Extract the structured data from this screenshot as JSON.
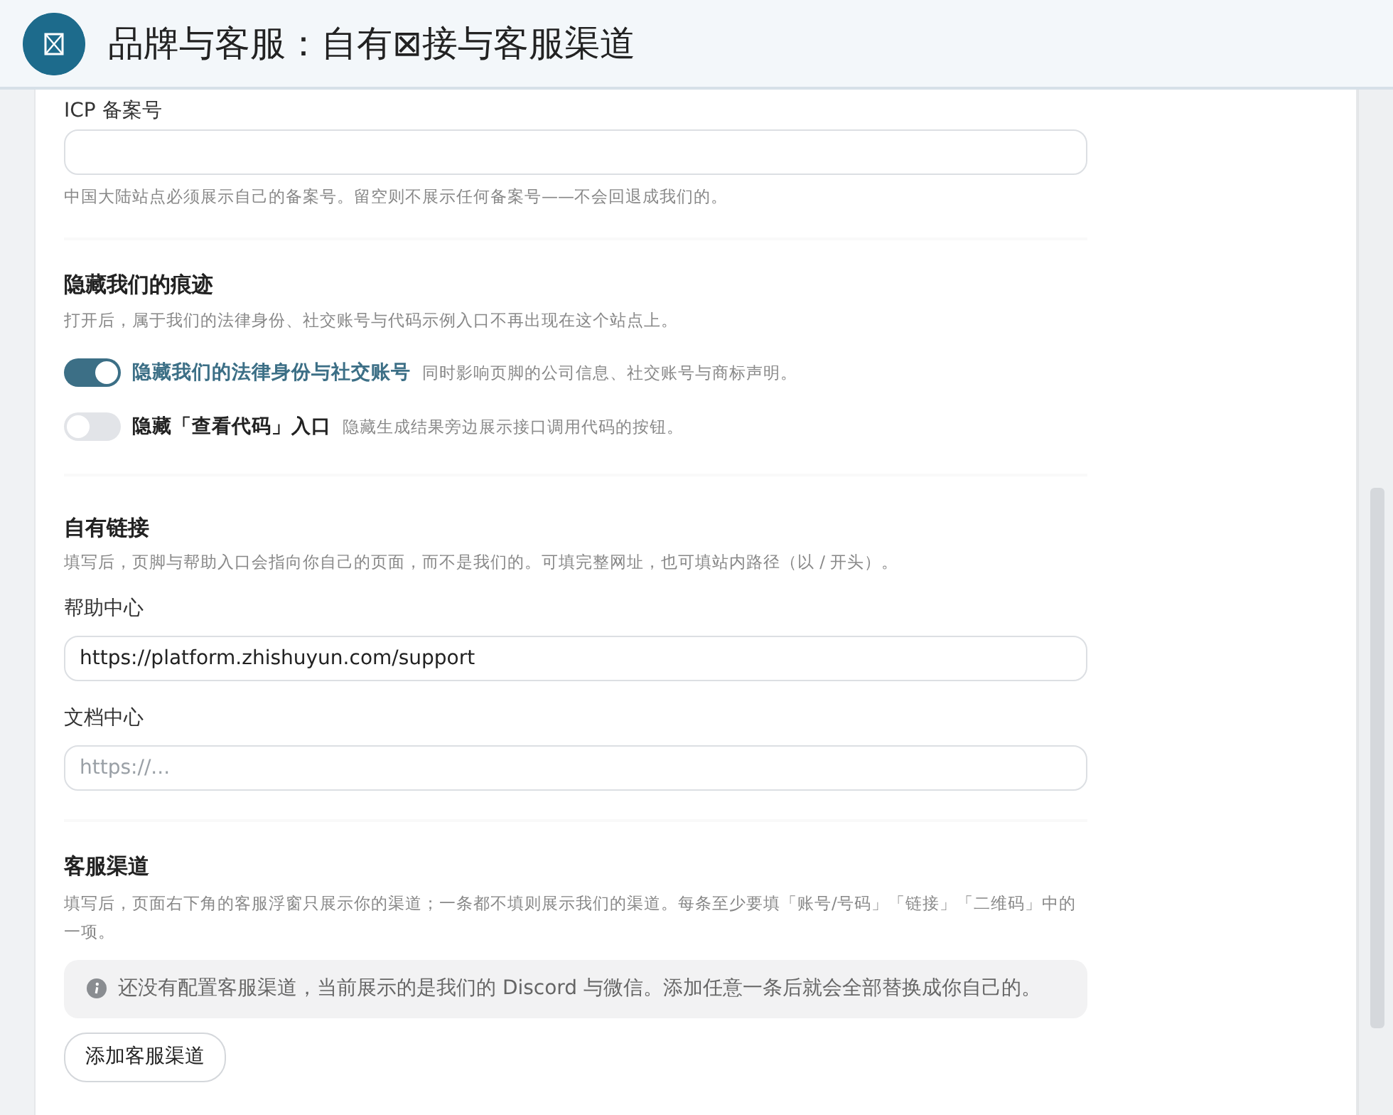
{
  "header": {
    "title": "品牌与客服：自有⊠接与客服渠道"
  },
  "icp": {
    "label": "ICP 备案号",
    "help": "中国大陆站点必须展示自己的备案号。留空则不展示任何备案号——不会回退成我们的。"
  },
  "hide_section": {
    "title": "隐藏我们的痕迹",
    "description": "打开后，属于我们的法律身份、社交账号与代码示例入口不再出现在这个站点上。",
    "toggles": [
      {
        "label": "隐藏我们的法律身份与社交账号",
        "hint": "同时影响页脚的公司信息、社交账号与商标声明。",
        "on": true
      },
      {
        "label": "隐藏「查看代码」入口",
        "hint": "隐藏生成结果旁边展示接口调用代码的按钮。",
        "on": false
      }
    ]
  },
  "links_section": {
    "title": "自有链接",
    "description": "填写后，页脚与帮助入口会指向你自己的页面，而不是我们的。可填完整网址，也可填站内路径（以 / 开头）。",
    "fields": [
      {
        "label": "帮助中心",
        "value": "https://platform.zhishuyun.com/support"
      },
      {
        "label": "文档中心",
        "placeholder": "https://..."
      }
    ]
  },
  "support_section": {
    "title": "客服渠道",
    "description": "填写后，页面右下角的客服浮窗只展示你的渠道；一条都不填则展示我们的渠道。每条至少要填「账号/号码」「链接」「二维码」中的一项。",
    "notice": "还没有配置客服渠道，当前展示的是我们的 Discord 与微信。添加任意一条后就会全部替换成你自己的。",
    "add_button": "添加客服渠道"
  }
}
